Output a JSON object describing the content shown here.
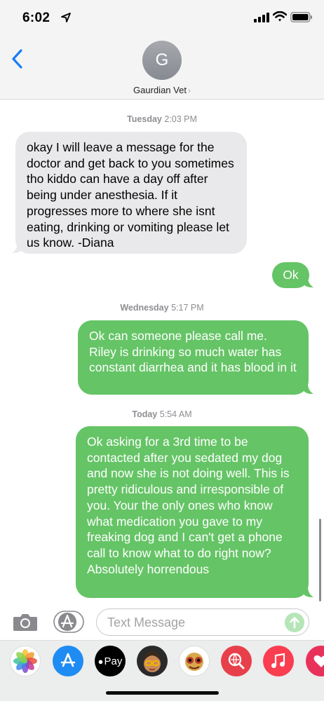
{
  "status_bar": {
    "time": "6:02"
  },
  "header": {
    "avatar_initial": "G",
    "contact_name": "Gaurdian Vet",
    "chevron": "›"
  },
  "messages": [
    {
      "stamp_day": "Tuesday",
      "stamp_time": "2:03 PM"
    },
    {
      "from": "them",
      "text": "okay I will leave a message for the doctor and get back to you sometimes tho kiddo can have a day off after being under anesthesia. If it progresses more to where she isnt eating, drinking or vomiting please let us know. -Diana"
    },
    {
      "from": "me",
      "text": "Ok"
    },
    {
      "stamp_day": "Wednesday",
      "stamp_time": "5:17 PM"
    },
    {
      "from": "me",
      "text": "Ok can someone please call me. Riley is drinking so much water has constant diarrhea and it has blood in it"
    },
    {
      "stamp_day": "Today",
      "stamp_time": "5:54 AM"
    },
    {
      "from": "me",
      "text": "Ok asking for a 3rd time to be contacted after you sedated my dog and now she is not doing well. This is pretty ridiculous and irresponsible of you. Your the only ones who know what medication you gave to my freaking dog and I can't get a phone call to know what to do right now? Absolutely horrendous"
    }
  ],
  "composer": {
    "placeholder": "Text Message"
  },
  "app_strip": [
    {
      "icon": "photos-icon"
    },
    {
      "icon": "app-store-icon"
    },
    {
      "icon": "apple-pay-icon",
      "label": "Pay"
    },
    {
      "icon": "memoji-icon"
    },
    {
      "icon": "animoji-icon"
    },
    {
      "icon": "web-search-icon"
    },
    {
      "icon": "music-icon"
    },
    {
      "icon": "digital-touch-icon"
    }
  ],
  "colors": {
    "outgoing": "#65c466",
    "incoming": "#e9e9eb",
    "accent": "#1a7cf5"
  }
}
